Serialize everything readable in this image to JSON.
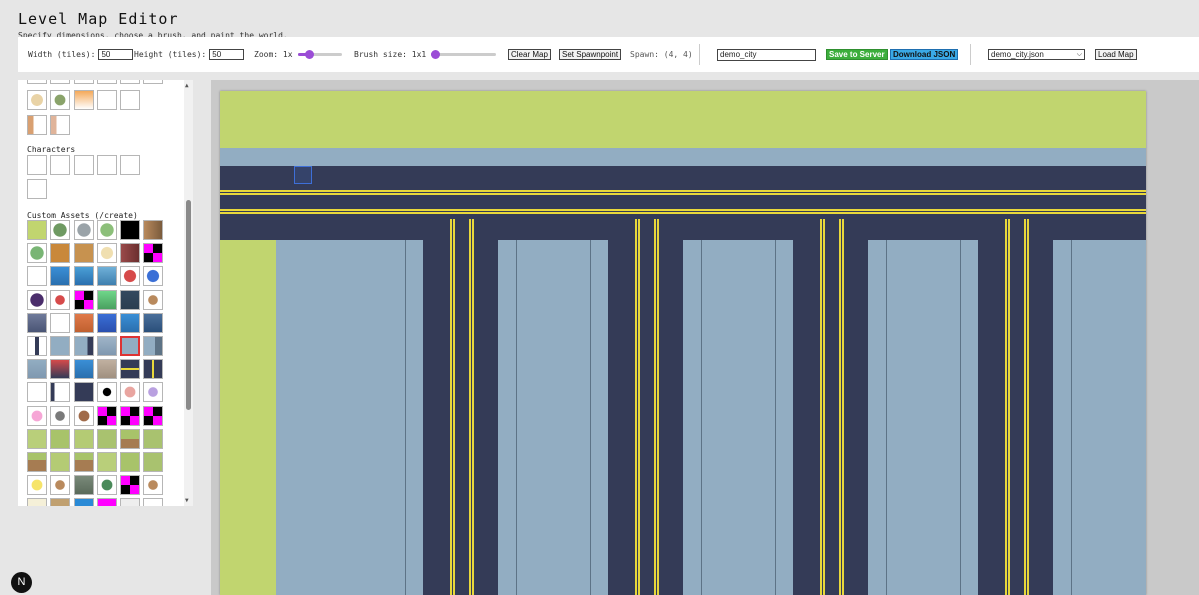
{
  "app": {
    "title": "Level Map Editor",
    "subtitle": "Specify dimensions, choose a brush, and paint the world."
  },
  "toolbar": {
    "width_label": "Width (tiles):",
    "width_value": "50",
    "height_label": "Height (tiles):",
    "height_value": "50",
    "zoom_label": "Zoom: 1x",
    "zoom_level": 0.2,
    "brush_label": "Brush size: 1x1",
    "brush_level": 0.0,
    "clear_label": "Clear Map",
    "spawn_button_label": "Set Spawnpoint",
    "spawn_text": "Spawn: (4, 4)",
    "map_name_value": "demo_city",
    "save_label": "Save to Server",
    "download_label": "Download JSON",
    "selected_map": "demo_city.json",
    "load_label": "Load Map"
  },
  "palette": {
    "characters_title": "Characters",
    "custom_title": "Custom Assets (/create)",
    "icons": [
      "scroll-up-icon",
      "scroll-down-icon"
    ]
  },
  "colors": {
    "grass": "#c1d56f",
    "road": "#343b57",
    "building": "#92adc2",
    "lane_marking": "#e8d83b",
    "save_button": "#3cae3c",
    "download_button": "#3aa9e6",
    "slider_accent": "#9b4dd6"
  },
  "logo": {
    "letter": "N"
  }
}
